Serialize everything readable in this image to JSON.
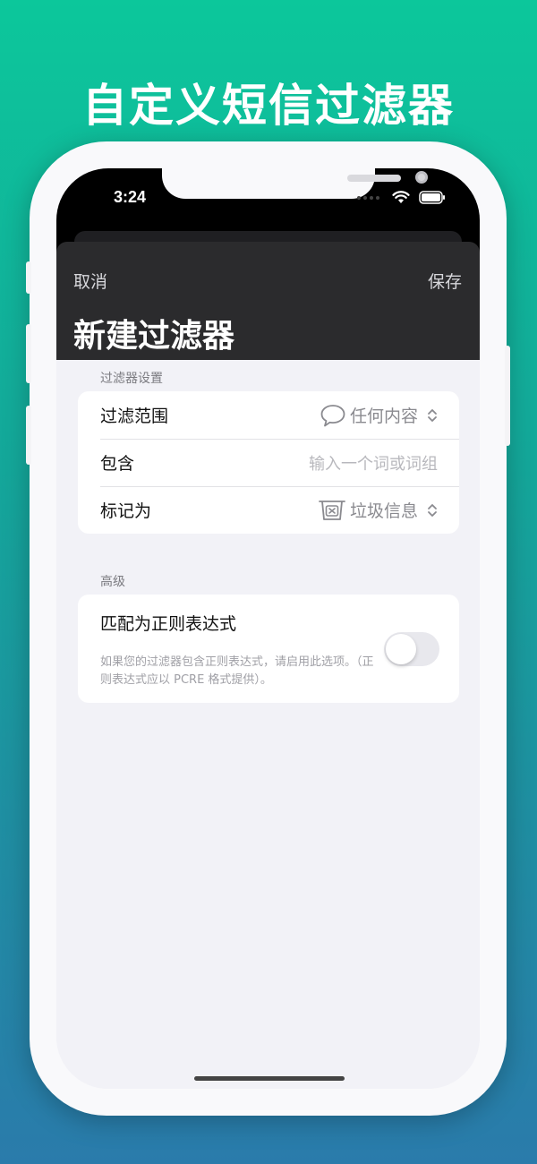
{
  "headline": "自定义短信过滤器",
  "status_bar": {
    "time": "3:24",
    "icons": [
      "signal-dots-icon",
      "wifi-icon",
      "battery-icon"
    ]
  },
  "sheet": {
    "cancel_label": "取消",
    "save_label": "保存",
    "title": "新建过滤器"
  },
  "filter_settings": {
    "section_label": "过滤器设置",
    "scope": {
      "label": "过滤范围",
      "value": "任何内容",
      "icon": "message-bubble-icon"
    },
    "contains": {
      "label": "包含",
      "placeholder": "输入一个词或词组"
    },
    "mark_as": {
      "label": "标记为",
      "value": "垃圾信息",
      "icon": "junk-tray-icon"
    }
  },
  "advanced": {
    "section_label": "高级",
    "regex": {
      "label": "匹配为正则表达式",
      "description": "如果您的过滤器包含正则表达式，请启用此选项。（正则表达式应以 PCRE 格式提供）。",
      "enabled": false
    }
  },
  "colors": {
    "gradient_top": "#0cc79b",
    "gradient_bottom": "#2a7bab",
    "header_bg": "#2b2b2d",
    "list_bg": "#f2f2f7"
  }
}
